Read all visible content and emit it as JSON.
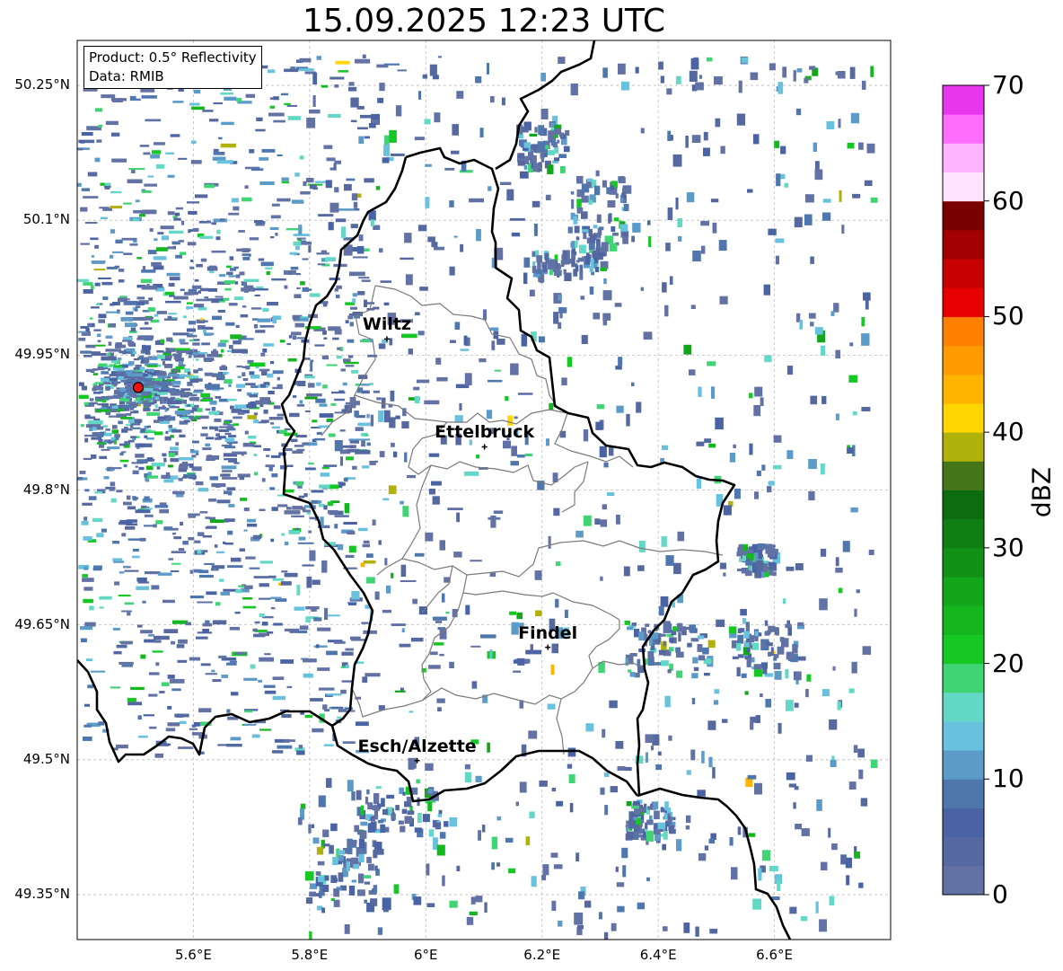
{
  "title": "15.09.2025 12:23 UTC",
  "info_box": {
    "product": "Product: 0.5° Reflectivity",
    "source": "Data: RMIB"
  },
  "axes": {
    "lat_ticks": [
      "50.25°N",
      "50.1°N",
      "49.95°N",
      "49.8°N",
      "49.65°N",
      "49.5°N",
      "49.35°N"
    ],
    "lon_ticks": [
      "5.6°E",
      "5.8°E",
      "6°E",
      "6.2°E",
      "6.4°E",
      "6.6°E"
    ],
    "lon_range": [
      5.4,
      6.8
    ],
    "lat_range": [
      49.3,
      50.3
    ],
    "grid": true
  },
  "colorbar": {
    "label": "dBZ",
    "ticks": [
      "0",
      "10",
      "20",
      "30",
      "40",
      "50",
      "60",
      "70"
    ],
    "range": [
      0,
      70
    ],
    "step": 2.5,
    "colors": [
      "#6272a4",
      "#5568a0",
      "#4a63a4",
      "#4f77ad",
      "#5c9bc8",
      "#68c2dd",
      "#64d8c6",
      "#40d474",
      "#16c823",
      "#14b71e",
      "#13a51a",
      "#119216",
      "#0f7f13",
      "#0d6b10",
      "#46761a",
      "#b1b10c",
      "#ffd600",
      "#ffb400",
      "#ff9a00",
      "#ff7f00",
      "#e80000",
      "#c70000",
      "#a20000",
      "#7a0000",
      "#ffe3ff",
      "#ffb4ff",
      "#ff6dff",
      "#e836ef"
    ]
  },
  "radar_site": {
    "lon": 5.505,
    "lat": 49.914,
    "color": "#ee1111"
  },
  "cities": [
    {
      "name": "Wiltz",
      "lon": 5.933,
      "lat": 49.968
    },
    {
      "name": "Ettelbruck",
      "lon": 6.101,
      "lat": 49.848
    },
    {
      "name": "Findel",
      "lon": 6.21,
      "lat": 49.625
    },
    {
      "name": "Esch/Alzette",
      "lon": 5.985,
      "lat": 49.499
    }
  ]
}
